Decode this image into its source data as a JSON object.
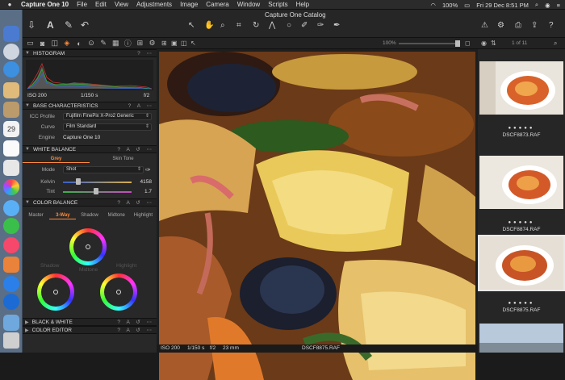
{
  "menubar": {
    "app": "Capture One 10",
    "items": [
      "File",
      "Edit",
      "View",
      "Adjustments",
      "Image",
      "Camera",
      "Window",
      "Scripts",
      "Help"
    ],
    "battery": "100%",
    "datetime": "Fri 29 Dec 8:51 PM"
  },
  "window": {
    "title": "Capture One Catalog"
  },
  "viewer": {
    "zoom": "100%",
    "filename": "DSCF8875.RAF",
    "iso": "ISO 200",
    "shutter": "1/150 s",
    "aperture": "f/2",
    "focal": "23 mm"
  },
  "browser": {
    "count": "1 of 11",
    "thumbs": [
      "DSCF8873.RAF",
      "DSCF8874.RAF",
      "DSCF8875.RAF"
    ]
  },
  "histogram": {
    "title": "HISTOGRAM",
    "iso": "ISO 200",
    "shutter": "1/150 s",
    "aperture": "f/2"
  },
  "base": {
    "title": "BASE CHARACTERISTICS",
    "icc_label": "ICC Profile",
    "icc": "Fujifilm FinePix X-Pro2 Generic",
    "curve_label": "Curve",
    "curve": "Film Standard",
    "engine_label": "Engine",
    "engine": "Capture One 10"
  },
  "wb": {
    "title": "WHITE BALANCE",
    "tabs": [
      "Grey",
      "Skin Tone"
    ],
    "mode_label": "Mode",
    "mode": "Shot",
    "kelvin_label": "Kelvin",
    "kelvin": "4158",
    "tint_label": "Tint",
    "tint": "1.7"
  },
  "cb": {
    "title": "COLOR BALANCE",
    "tabs": [
      "Master",
      "3-Way",
      "Shadow",
      "Midtone",
      "Highlight"
    ],
    "shadow": "Shadow",
    "midtone": "Midtone",
    "highlight": "Highlight"
  },
  "bw": {
    "title": "BLACK & WHITE"
  },
  "ce": {
    "title": "COLOR EDITOR"
  },
  "colors": {
    "accent": "#ff8a3c"
  }
}
